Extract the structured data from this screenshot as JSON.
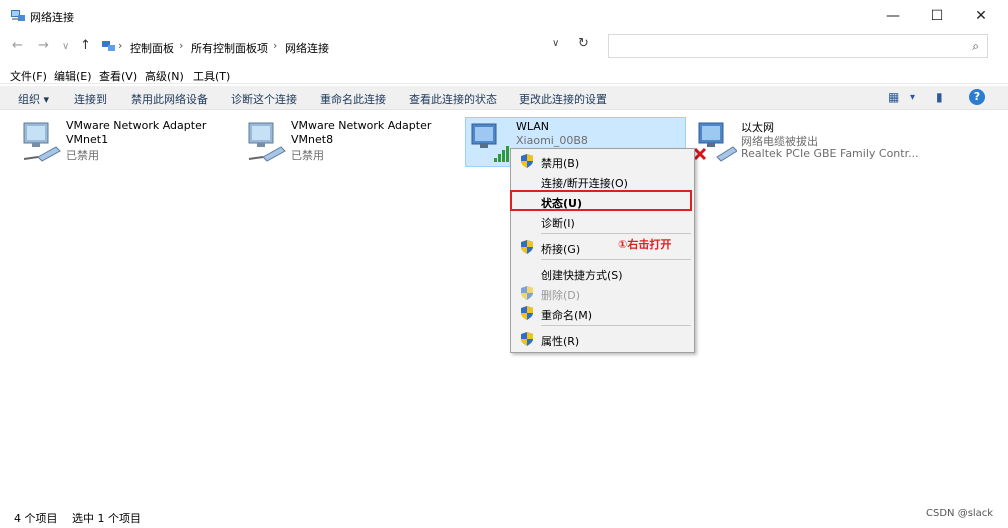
{
  "window": {
    "title": "网络连接",
    "controls": {
      "minimize": "—",
      "maximize": "☐",
      "close": "✕"
    }
  },
  "nav": {
    "back": "←",
    "forward": "→",
    "recent": "∨",
    "up": "↑",
    "dropdown": "∨",
    "refresh": "↻"
  },
  "breadcrumb": {
    "items": [
      "控制面板",
      "所有控制面板项",
      "网络连接"
    ],
    "separator": "›"
  },
  "search": {
    "placeholder": "",
    "icon": "⌕"
  },
  "menubar": [
    "文件(F)",
    "编辑(E)",
    "查看(V)",
    "高级(N)",
    "工具(T)"
  ],
  "commands": [
    "组织 ▾",
    "连接到",
    "禁用此网络设备",
    "诊断这个连接",
    "重命名此连接",
    "查看此连接的状态",
    "更改此连接的设置"
  ],
  "command_right": {
    "view_icon": "▦",
    "view_dropdown": "▾",
    "pane_icon": "▮",
    "help": "?"
  },
  "adapters": [
    {
      "name": "VMware Network Adapter",
      "sub": "VMnet1",
      "status": "已禁用"
    },
    {
      "name": "VMware Network Adapter",
      "sub": "VMnet8",
      "status": "已禁用"
    },
    {
      "name": "WLAN",
      "sub": "Xiaomi_00B8",
      "status": ""
    },
    {
      "name": "以太网",
      "sub": "网络电缆被拔出",
      "status": "Realtek PCIe GBE Family Contr..."
    }
  ],
  "context_menu": [
    {
      "label": "禁用(B)"
    },
    {
      "label": "连接/断开连接(O)"
    },
    {
      "label": "状态(U)"
    },
    {
      "label": "诊断(I)"
    },
    {
      "label": "桥接(G)"
    },
    {
      "label": "创建快捷方式(S)"
    },
    {
      "label": "删除(D)"
    },
    {
      "label": "重命名(M)"
    },
    {
      "label": "属性(R)"
    }
  ],
  "annotation": "①右击打开",
  "statusbar": {
    "count": "4 个项目",
    "selected": "选中 1 个项目"
  },
  "watermark": "CSDN @slack",
  "colors": {
    "selection": "#cce8ff",
    "accent": "#e02020",
    "help": "#2b7cd3"
  }
}
